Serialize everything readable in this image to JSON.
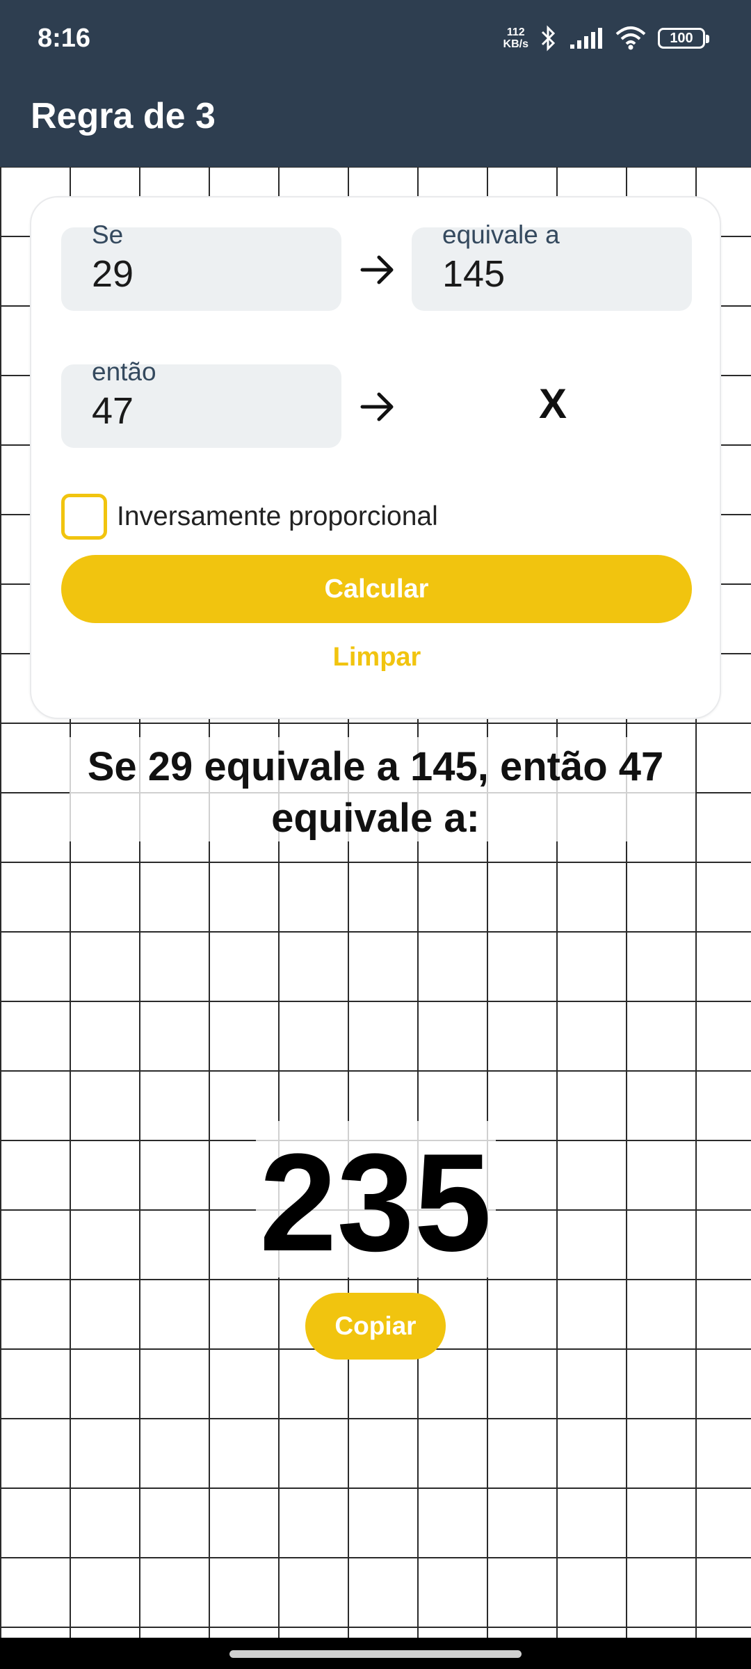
{
  "status_bar": {
    "time": "8:16",
    "net_speed_value": "112",
    "net_speed_unit": "KB/s",
    "battery": "100"
  },
  "app_bar": {
    "title": "Regra de 3"
  },
  "form": {
    "row1": {
      "left": {
        "label": "Se",
        "value": "29"
      },
      "right": {
        "label": "equivale a",
        "value": "145"
      }
    },
    "row2": {
      "left": {
        "label": "então",
        "value": "47"
      },
      "unknown": "X"
    },
    "inverse_checkbox": {
      "label": "Inversamente proporcional",
      "checked": false
    },
    "calculate_label": "Calcular",
    "clear_label": "Limpar"
  },
  "result": {
    "sentence": "Se 29 equivale a 145, então 47 equivale a:",
    "value": "235",
    "copy_label": "Copiar"
  },
  "colors": {
    "app_bar": "#2e3e50",
    "accent": "#f1c40f",
    "field_bg": "#edf0f2"
  }
}
